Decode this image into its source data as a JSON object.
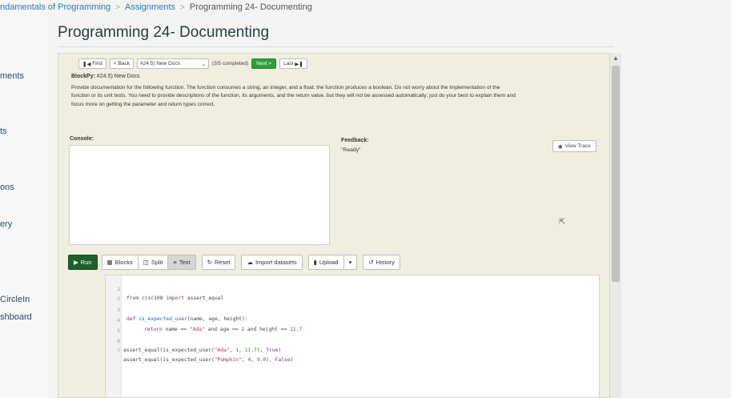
{
  "breadcrumb": {
    "course": "ndamentals of Programming",
    "section": "Assignments",
    "current": "Programming 24- Documenting"
  },
  "leftnav": [
    "ments",
    "ts",
    "ons",
    "ery",
    "CircleIn",
    "shboard"
  ],
  "page_title": "Programming 24- Documenting",
  "navbar": {
    "first": "First",
    "back": "Back",
    "select_value": "#24.5) New Docs",
    "count": "(3/5 completed)",
    "next": "Next",
    "last": "Last"
  },
  "problem": {
    "label": "BlockPy:",
    "title": "#24.5) New Docs",
    "description": "Provide documentation for the following function. The function consumes a string, an integer, and a float; the function produces a boolean. Do not worry about the implementation of the function or its unit tests. You need to provide descriptions of the function, its arguments, and the return value, but they will not be assessed automatically; just do your best to explain them and focus more on getting the parameter and return types correct."
  },
  "console_label": "Console:",
  "feedback": {
    "label": "Feedback:",
    "text": "\"Ready\""
  },
  "view_trace": "View Trace",
  "toolbar": {
    "run": "Run",
    "blocks": "Blocks",
    "split": "Split",
    "text": "Text",
    "reset": "Reset",
    "import": "Import datasets",
    "upload": "Upload",
    "history": "History"
  },
  "code": {
    "line_numbers": [
      "1",
      "2",
      "3",
      "4",
      "5",
      "6",
      "7"
    ],
    "l1": {
      "kw1": "from",
      "mod": " cisc108 ",
      "kw2": "import",
      "name": " assert_equal"
    },
    "l3": {
      "kw": "def",
      "fn": " is_expected_user",
      "args": "(name, age, height):"
    },
    "l4": {
      "kw": "return",
      "a": " name == ",
      "s": "\"Ada\"",
      "b": " and age == ",
      "n1": "1",
      "c": " and height == ",
      "n2": "11.7"
    },
    "l6": {
      "a": "assert_equal(is_expected_user(",
      "s": "\"Ada\"",
      "b": ", ",
      "n1": "1",
      "c": ", ",
      "n2": "11.7",
      "d": "), ",
      "r": "True",
      "e": ")"
    },
    "l7": {
      "a": "assert_equal(is_expected_user(",
      "s": "\"Pumpkin\"",
      "b": ", ",
      "n1": "4",
      "c": ", ",
      "n2": "9.0",
      "d": "), ",
      "r": "False",
      "e": ")"
    }
  }
}
